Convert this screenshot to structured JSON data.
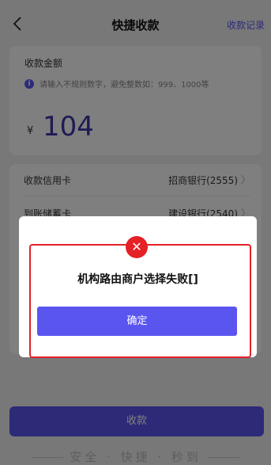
{
  "nav": {
    "title": "快捷收款",
    "records_label": "收款记录"
  },
  "amount_card": {
    "label": "收款金额",
    "tip": "请输入不规则数字，避免整数如：999、1000等",
    "currency": "¥",
    "amount": "104"
  },
  "cards": [
    {
      "key": "收款信用卡",
      "value": "招商银行(2555)"
    },
    {
      "key": "到账储蓄卡",
      "value": "建设银行(2540)"
    }
  ],
  "submit_label": "收款",
  "slogan": "安全 · 快捷 · 秒到",
  "dialog": {
    "message": "机构路由商户选择失败[]",
    "confirm_label": "确定"
  },
  "colors": {
    "accent": "#5b55f0",
    "error": "#e42127"
  }
}
